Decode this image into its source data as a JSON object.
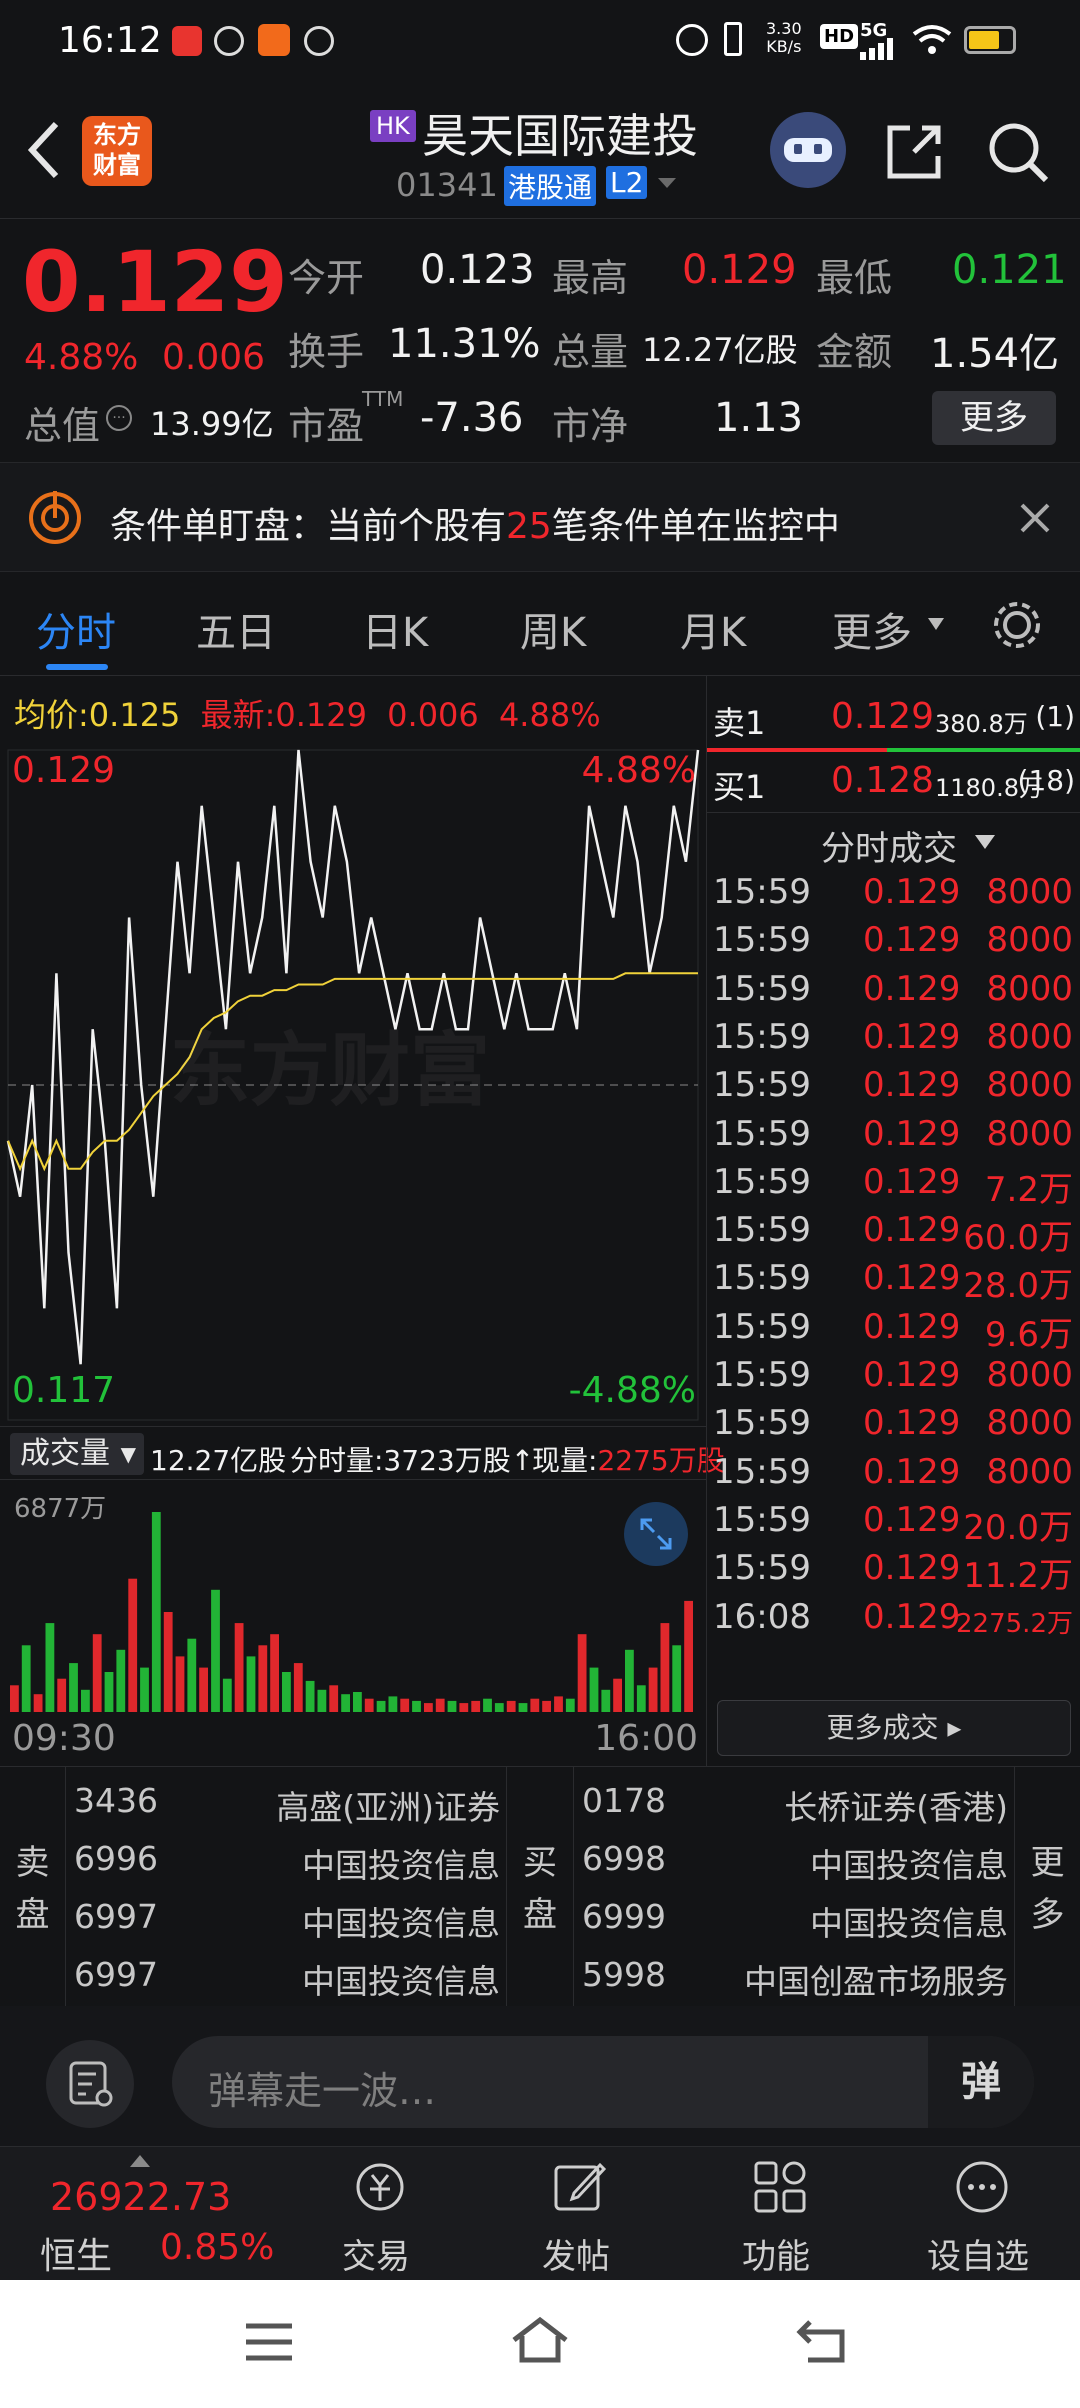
{
  "status": {
    "time": "16:12",
    "net_speed_top": "3.30",
    "net_speed_bottom": "KB/s",
    "hd": "HD",
    "fiveg": "5G"
  },
  "header": {
    "logo_line1": "东方",
    "logo_line2": "财富",
    "market_badge": "HK",
    "stock_name": "昊天国际建投",
    "stock_code": "01341",
    "connect_badge": "港股通",
    "level_badge": "L2"
  },
  "quote": {
    "price": "0.129",
    "change_pct": "4.88%",
    "change_amt": "0.006",
    "open_label": "今开",
    "open": "0.123",
    "high_label": "最高",
    "high": "0.129",
    "low_label": "最低",
    "low": "0.121",
    "turnover_label": "换手",
    "turnover": "11.31%",
    "volume_label": "总量",
    "volume": "12.27亿股",
    "amount_label": "金额",
    "amount": "1.54亿",
    "mktcap_label": "总值",
    "mktcap": "13.99亿",
    "pe_label": "市盈",
    "pe_sup": "TTM",
    "pe": "-7.36",
    "pb_label": "市净",
    "pb": "1.13",
    "more_button": "更多"
  },
  "alert": {
    "prefix": "条件单盯盘：当前个股有",
    "count": "25",
    "suffix": "笔条件单在监控中"
  },
  "tabs": [
    {
      "label": "分时"
    },
    {
      "label": "五日"
    },
    {
      "label": "日K"
    },
    {
      "label": "周K"
    },
    {
      "label": "月K"
    },
    {
      "label": "更多"
    }
  ],
  "chart": {
    "avg_label": "均价:",
    "avg_value": "0.125",
    "latest_label": "最新:",
    "latest_value": "0.129",
    "latest_chg": "0.006",
    "latest_pct": "4.88%",
    "y_top": "0.129",
    "y_bottom": "0.117",
    "pct_top": "4.88%",
    "pct_bottom": "-4.88%",
    "watermark": "东方财富",
    "vol_selector": "成交量",
    "vol_total": "12.27亿股",
    "vol_fenshi": "分时量:3723万股↑",
    "vol_now_label": "现量:",
    "vol_now": "2275万股",
    "vol_max": "6877万",
    "time_start": "09:30",
    "time_end": "16:00"
  },
  "chart_data": {
    "type": "line",
    "x_range": [
      "09:30",
      "16:00"
    ],
    "ylim": [
      0.117,
      0.129
    ],
    "pct_range": [
      "-4.88%",
      "4.88%"
    ],
    "prev_close": 0.123,
    "series": [
      {
        "values": [
          0.122,
          0.121,
          0.123,
          0.119,
          0.125,
          0.12,
          0.118,
          0.124,
          0.122,
          0.119,
          0.126,
          0.123,
          0.121,
          0.124,
          0.127,
          0.125,
          0.128,
          0.126,
          0.124,
          0.127,
          0.125,
          0.126,
          0.128,
          0.125,
          0.129,
          0.127,
          0.126,
          0.128,
          0.127,
          0.125,
          0.126,
          0.125,
          0.124,
          0.125,
          0.124,
          0.124,
          0.125,
          0.124,
          0.124,
          0.126,
          0.125,
          0.124,
          0.125,
          0.124,
          0.124,
          0.124,
          0.125,
          0.124,
          0.128,
          0.127,
          0.126,
          0.128,
          0.127,
          0.125,
          0.126,
          0.128,
          0.127,
          0.129
        ]
      },
      {
        "values": [
          0.122,
          0.1215,
          0.122,
          0.1215,
          0.122,
          0.1215,
          0.1215,
          0.1218,
          0.122,
          0.122,
          0.1222,
          0.1225,
          0.1228,
          0.123,
          0.1232,
          0.1235,
          0.124,
          0.1242,
          0.1243,
          0.1245,
          0.1246,
          0.1246,
          0.1247,
          0.1247,
          0.1248,
          0.1248,
          0.1248,
          0.1249,
          0.1249,
          0.1249,
          0.1249,
          0.1249,
          0.1249,
          0.1249,
          0.1249,
          0.1249,
          0.1249,
          0.1249,
          0.1249,
          0.1249,
          0.1249,
          0.1249,
          0.1249,
          0.1249,
          0.1249,
          0.1249,
          0.1249,
          0.1249,
          0.1249,
          0.1249,
          0.1249,
          0.125,
          0.125,
          0.125,
          0.125,
          0.125,
          0.125,
          0.125
        ]
      }
    ],
    "volume": [
      12,
      30,
      8,
      40,
      15,
      22,
      10,
      35,
      18,
      28,
      60,
      20,
      90,
      45,
      25,
      33,
      20,
      55,
      15,
      40,
      25,
      30,
      35,
      18,
      22,
      14,
      10,
      12,
      8,
      9,
      6,
      5,
      7,
      6,
      5,
      4,
      6,
      5,
      4,
      5,
      6,
      4,
      5,
      4,
      6,
      5,
      7,
      6,
      35,
      20,
      10,
      15,
      28,
      12,
      20,
      40,
      30,
      50
    ]
  },
  "orderbook": {
    "sell_label": "卖1",
    "sell_price": "0.129",
    "sell_vol": "380.8万",
    "sell_count": "(1)",
    "buy_label": "买1",
    "buy_price": "0.128",
    "buy_vol": "1180.8万",
    "buy_count": "(18)"
  },
  "trades_header": "分时成交",
  "trades": [
    {
      "time": "15:59",
      "price": "0.129",
      "vol": "8000"
    },
    {
      "time": "15:59",
      "price": "0.129",
      "vol": "8000"
    },
    {
      "time": "15:59",
      "price": "0.129",
      "vol": "8000"
    },
    {
      "time": "15:59",
      "price": "0.129",
      "vol": "8000"
    },
    {
      "time": "15:59",
      "price": "0.129",
      "vol": "8000"
    },
    {
      "time": "15:59",
      "price": "0.129",
      "vol": "8000"
    },
    {
      "time": "15:59",
      "price": "0.129",
      "vol": "7.2万"
    },
    {
      "time": "15:59",
      "price": "0.129",
      "vol": "60.0万"
    },
    {
      "time": "15:59",
      "price": "0.129",
      "vol": "28.0万"
    },
    {
      "time": "15:59",
      "price": "0.129",
      "vol": "9.6万"
    },
    {
      "time": "15:59",
      "price": "0.129",
      "vol": "8000"
    },
    {
      "time": "15:59",
      "price": "0.129",
      "vol": "8000"
    },
    {
      "time": "15:59",
      "price": "0.129",
      "vol": "8000"
    },
    {
      "time": "15:59",
      "price": "0.129",
      "vol": "20.0万"
    },
    {
      "time": "15:59",
      "price": "0.129",
      "vol": "11.2万"
    },
    {
      "time": "16:08",
      "price": "0.129",
      "vol": "2275.2万"
    }
  ],
  "more_trades": "更多成交",
  "brokers": {
    "sell_label_1": "卖",
    "sell_label_2": "盘",
    "buy_label_1": "买",
    "buy_label_2": "盘",
    "more_1": "更",
    "more_2": "多",
    "sell": [
      {
        "id": "3436",
        "name": "高盛(亚洲)证券"
      },
      {
        "id": "6996",
        "name": "中国投资信息"
      },
      {
        "id": "6997",
        "name": "中国投资信息"
      },
      {
        "id": "6997",
        "name": "中国投资信息"
      }
    ],
    "buy": [
      {
        "id": "0178",
        "name": "长桥证券(香港)"
      },
      {
        "id": "6998",
        "name": "中国投资信息"
      },
      {
        "id": "6999",
        "name": "中国投资信息"
      },
      {
        "id": "5998",
        "name": "中国创盈市场服务"
      }
    ]
  },
  "danmu": {
    "placeholder": "弹幕走一波…",
    "toggle": "弹"
  },
  "bottom_nav": {
    "index_value": "26922.73",
    "index_name": "恒生",
    "index_pct": "0.85%",
    "items": [
      {
        "label": "交易"
      },
      {
        "label": "发帖"
      },
      {
        "label": "功能"
      },
      {
        "label": "设自选"
      }
    ]
  }
}
